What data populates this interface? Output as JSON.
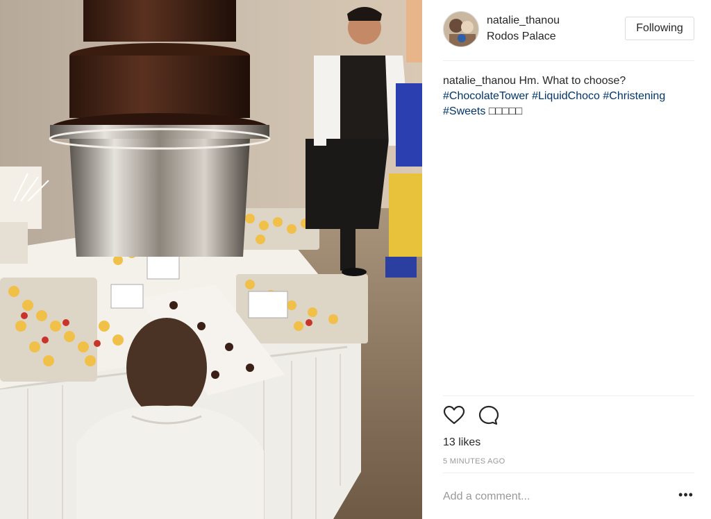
{
  "post": {
    "photo_alt": "Chocolate fountain at a dessert buffet"
  },
  "header": {
    "username": "natalie_thanou",
    "location": "Rodos Palace",
    "follow_label": "Following"
  },
  "caption": {
    "author": "natalie_thanou",
    "text": "Hm. What to choose?",
    "hashtags": [
      "#ChocolateTower",
      "#LiquidChoco",
      "#Christening",
      "#Sweets"
    ],
    "emoji": "□□□□□"
  },
  "actions": {
    "like_icon": "heart-icon",
    "comment_icon": "comment-bubble-icon",
    "likes": "13 likes",
    "timestamp": "5 MINUTES AGO"
  },
  "comment": {
    "placeholder": "Add a comment...",
    "more_label": "•••"
  }
}
